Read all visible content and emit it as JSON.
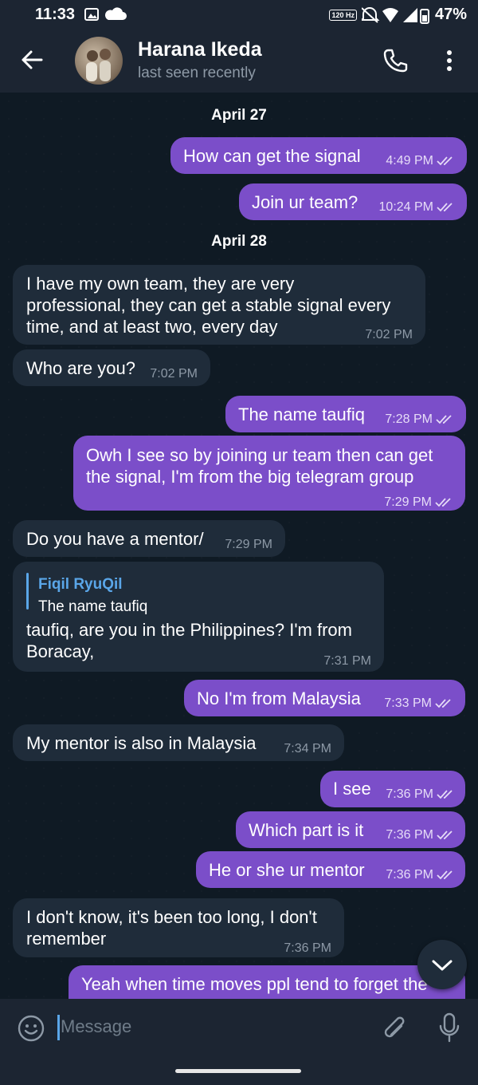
{
  "status_bar": {
    "time": "11:33",
    "battery": "47%",
    "refresh": "120 Hz"
  },
  "header": {
    "name": "Harana Ikeda",
    "status": "last seen recently"
  },
  "dates": [
    "April 27",
    "April 28"
  ],
  "messages": [
    {
      "side": "out",
      "text": "How can get the signal",
      "time": "4:49 PM"
    },
    {
      "side": "out",
      "text": "Join ur team?",
      "time": "10:24 PM"
    },
    {
      "side": "in",
      "lines": [
        "I have my own team, they are very",
        "professional, they can get a stable signal every",
        "time, and at least two, every day"
      ],
      "time": "7:02 PM"
    },
    {
      "side": "in",
      "text": "Who are you?",
      "time": "7:02 PM"
    },
    {
      "side": "out",
      "text": "The name taufiq",
      "time": "7:28 PM"
    },
    {
      "side": "out",
      "lines": [
        "Owh I see so by joining ur team then can get",
        "the signal, I'm from the big telegram group"
      ],
      "time": "7:29 PM"
    },
    {
      "side": "in",
      "text": "Do you have a mentor/",
      "time": "7:29 PM"
    },
    {
      "side": "in",
      "reply": {
        "name": "Fiqil RyuQil",
        "text": "The name taufiq"
      },
      "lines": [
        "taufiq, are you in the Philippines? I'm from",
        "Boracay,"
      ],
      "time": "7:31 PM"
    },
    {
      "side": "out",
      "text": "No I'm from Malaysia",
      "time": "7:33 PM"
    },
    {
      "side": "in",
      "text": "My mentor is also in Malaysia",
      "time": "7:34 PM"
    },
    {
      "side": "out",
      "text": "I see",
      "time": "7:36 PM"
    },
    {
      "side": "out",
      "text": "Which part is it",
      "time": "7:36 PM"
    },
    {
      "side": "out",
      "text": "He or she ur mentor",
      "time": "7:36 PM"
    },
    {
      "side": "in",
      "lines": [
        "I don't know, it's been too long, I don't",
        "remember"
      ],
      "time": "7:36 PM"
    },
    {
      "side": "out",
      "text": "Yeah when time moves ppl tend to forget the"
    }
  ],
  "input": {
    "placeholder": "Message"
  },
  "icons": [
    "back-arrow-icon",
    "phone-icon",
    "more-vertical-icon",
    "emoji-icon",
    "attach-icon",
    "mic-icon",
    "chevron-down-icon",
    "double-check-icon"
  ],
  "colors": {
    "background": "#0e1621",
    "incoming": "#1f2c3a",
    "outgoing": "#7b4ec9",
    "accent": "#5aa6e8"
  }
}
